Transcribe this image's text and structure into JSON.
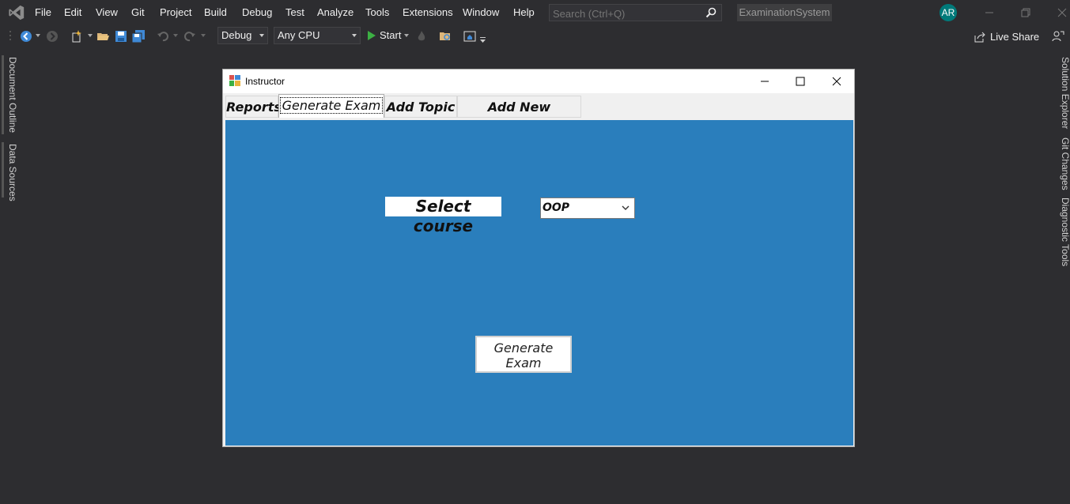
{
  "menubar": {
    "items": [
      "File",
      "Edit",
      "View",
      "Git",
      "Project",
      "Build",
      "Debug",
      "Test",
      "Analyze",
      "Tools",
      "Extensions",
      "Window",
      "Help"
    ],
    "search_placeholder": "Search (Ctrl+Q)",
    "solution_name": "ExaminationSystem",
    "avatar_initials": "AR"
  },
  "toolbar": {
    "configuration": "Debug",
    "platform": "Any CPU",
    "start_label": "Start",
    "live_share_label": "Live Share"
  },
  "side_tabs": {
    "left": [
      "Document Outline",
      "Data Sources"
    ],
    "right": [
      "Solution Explorer",
      "Git Changes",
      "Diagnostic Tools"
    ]
  },
  "form": {
    "title": "Instructor",
    "tabs": [
      "Reports",
      "Generate Exam",
      "Add Topic",
      "Add New Question"
    ],
    "selected_tab": "Generate Exam",
    "select_course_label": "Select course",
    "course_value": "OOP",
    "generate_button_label": "Generate\nExam",
    "panel_color": "#2a7ebc"
  },
  "colors": {
    "ide_background": "#2d2d30",
    "accent": "#007acc"
  }
}
